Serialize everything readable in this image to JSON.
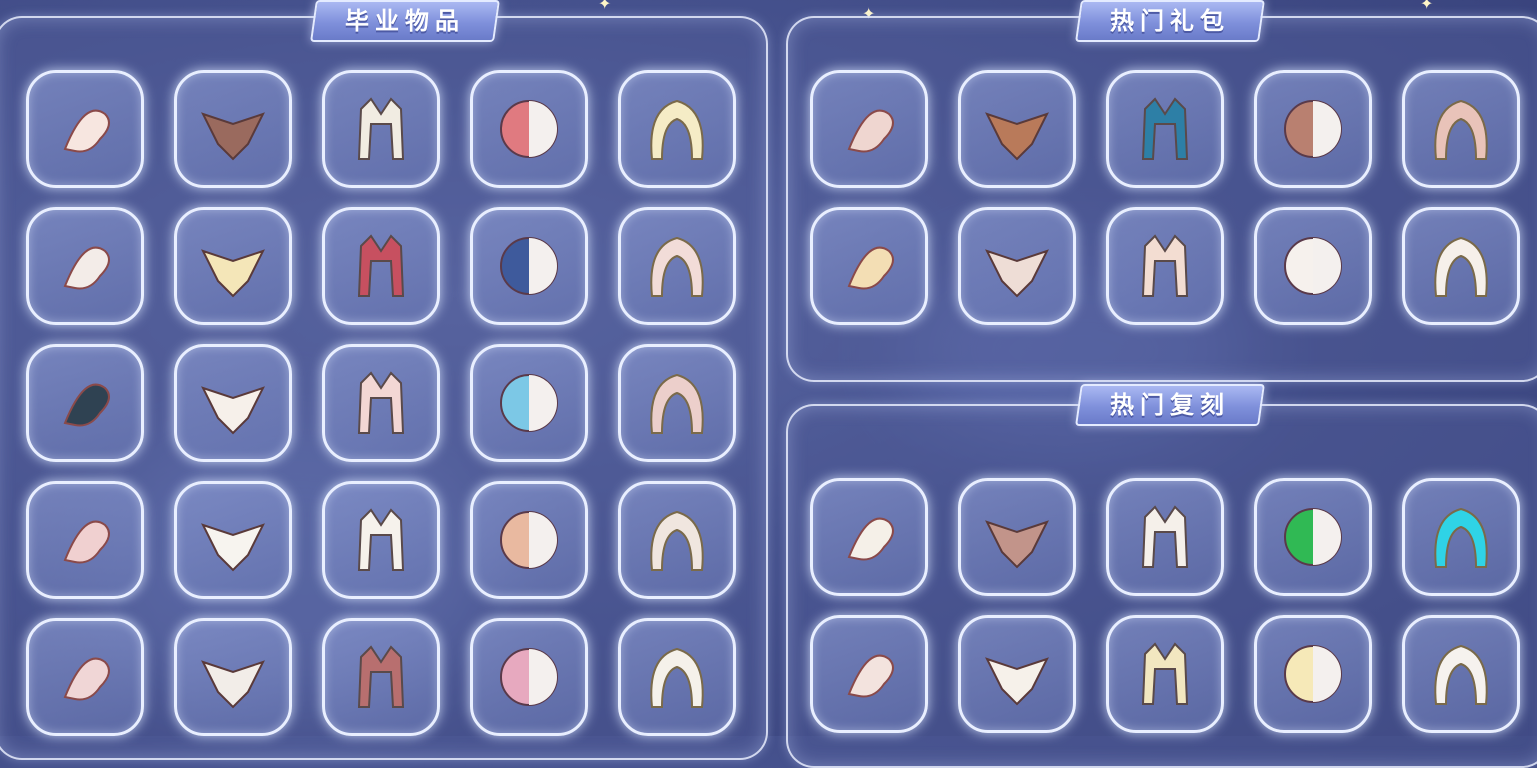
{
  "sections": {
    "graduation": {
      "title": "毕业物品"
    },
    "hot_packs": {
      "title": "热门礼包"
    },
    "hot_reruns": {
      "title": "热门复刻"
    }
  },
  "graduation_items": [
    {
      "icon": "dragon-hair-accessory-icon",
      "color": "#f7e6e0"
    },
    {
      "icon": "owl-cape-icon",
      "color": "#9a6a5e"
    },
    {
      "icon": "cat-ear-hair-icon",
      "color": "#f1ece2"
    },
    {
      "icon": "half-moon-mask-icon",
      "color": "#e07a80"
    },
    {
      "icon": "long-blonde-hair-icon",
      "color": "#f5ecc6"
    },
    {
      "icon": "petal-necklace-icon",
      "color": "#f3ece8"
    },
    {
      "icon": "spiky-blonde-hair-icon",
      "color": "#f4e6b8"
    },
    {
      "icon": "antler-mask-icon",
      "color": "#c75060"
    },
    {
      "icon": "blue-cape-icon",
      "color": "#3e5a9c"
    },
    {
      "icon": "pink-winged-cape-icon",
      "color": "#f2dcd8"
    },
    {
      "icon": "dark-feather-cape-icon",
      "color": "#2f4252"
    },
    {
      "icon": "bob-hair-icon",
      "color": "#f6f0ea"
    },
    {
      "icon": "pink-outfit-icon",
      "color": "#f3d7d4"
    },
    {
      "icon": "butterfly-cape-icon",
      "color": "#7cc8e6"
    },
    {
      "icon": "scarf-icon",
      "color": "#eccfcb"
    },
    {
      "icon": "shell-prop-icon",
      "color": "#f0d0d0"
    },
    {
      "icon": "moomin-plush-icon",
      "color": "#f7f4ef"
    },
    {
      "icon": "music-umbrella-icon",
      "color": "#f6f2ec"
    },
    {
      "icon": "bandage-cape-icon",
      "color": "#e9b9a0"
    },
    {
      "icon": "deer-mask-icon",
      "color": "#f0e6df"
    },
    {
      "icon": "blue-pink-cape-icon",
      "color": "#f0d6d6"
    },
    {
      "icon": "angel-wing-halo-icon",
      "color": "#f2ede8"
    },
    {
      "icon": "diamond-headpiece-icon",
      "color": "#b86f6f"
    },
    {
      "icon": "pink-hooded-cape-icon",
      "color": "#e7a9bf"
    },
    {
      "icon": "white-boots-icon",
      "color": "#f5f1ea"
    }
  ],
  "hot_pack_items": [
    {
      "icon": "moon-hair-pin-icon",
      "color": "#efd6d0"
    },
    {
      "icon": "fox-plush-icon",
      "color": "#b97a5a"
    },
    {
      "icon": "teal-cape-icon",
      "color": "#2d7fa6"
    },
    {
      "icon": "closed-eyes-mask-icon",
      "color": "#b98070"
    },
    {
      "icon": "flower-hair-pin-icon",
      "color": "#e9c3b9"
    },
    {
      "icon": "ponytail-hair-icon",
      "color": "#f3deb4"
    },
    {
      "icon": "round-glasses-icon",
      "color": "#eeddd6"
    },
    {
      "icon": "hanfu-dress-icon",
      "color": "#f3ddd2"
    },
    {
      "icon": "white-robe-icon",
      "color": "#f6f1ed"
    },
    {
      "icon": "star-moon-headband-icon",
      "color": "#f6f0ea"
    }
  ],
  "hot_rerun_items": [
    {
      "icon": "guitar-icon",
      "color": "#f5f0e8"
    },
    {
      "icon": "blush-mask-icon",
      "color": "#c2948a"
    },
    {
      "icon": "twin-tail-hair-icon",
      "color": "#f5f0ea"
    },
    {
      "icon": "green-leaf-cape-icon",
      "color": "#30b954"
    },
    {
      "icon": "cyan-cloud-cape-icon",
      "color": "#2fd3e6"
    },
    {
      "icon": "swordsman-outfit-icon",
      "color": "#f3e3de"
    },
    {
      "icon": "white-pants-icon",
      "color": "#f6f1ea"
    },
    {
      "icon": "curly-hair-icon",
      "color": "#f2e7c0"
    },
    {
      "icon": "blonde-short-hair-icon",
      "color": "#f6e9b8"
    },
    {
      "icon": "cat-hood-hair-icon",
      "color": "#f6f2ee"
    }
  ]
}
